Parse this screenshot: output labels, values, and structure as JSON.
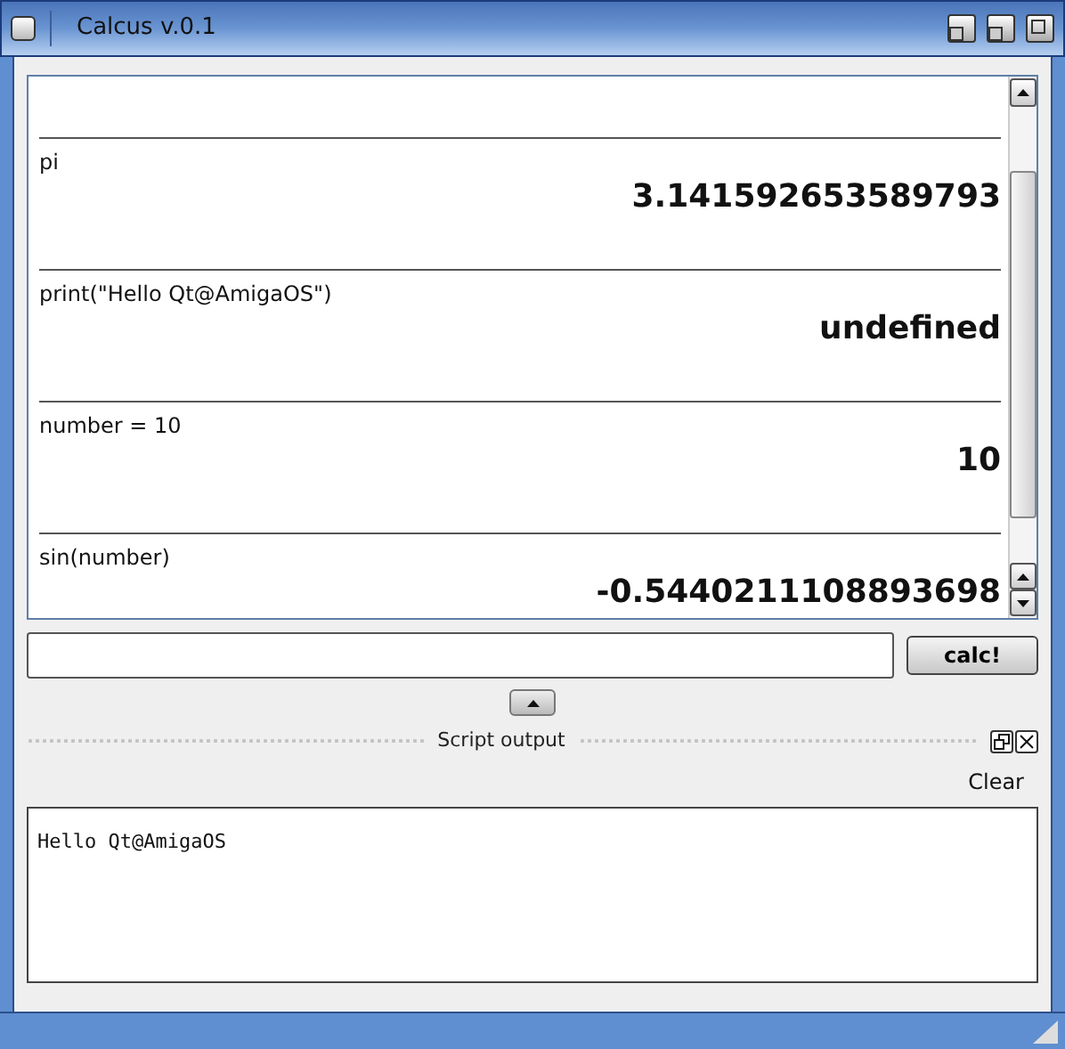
{
  "window": {
    "title": "Calcus v.0.1"
  },
  "history": [
    {
      "expression": "pi",
      "result": "3.141592653589793"
    },
    {
      "expression": "print(\"Hello Qt@AmigaOS\")",
      "result": "undefined"
    },
    {
      "expression": "number = 10",
      "result": "10"
    },
    {
      "expression": "sin(number)",
      "result": "-0.5440211108893698"
    }
  ],
  "calc_button": "calc!",
  "dock": {
    "title": "Script output",
    "clear_button": "Clear",
    "output": "Hello Qt@AmigaOS"
  }
}
